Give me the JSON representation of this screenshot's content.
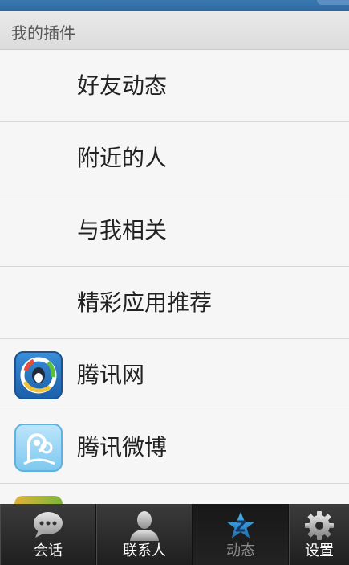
{
  "section": {
    "title": "我的插件"
  },
  "items": [
    {
      "label": "好友动态",
      "icon": null
    },
    {
      "label": "附近的人",
      "icon": null
    },
    {
      "label": "与我相关",
      "icon": null
    },
    {
      "label": "精彩应用推荐",
      "icon": null
    },
    {
      "label": "腾讯网",
      "icon": "tencent-news-icon"
    },
    {
      "label": "腾讯微博",
      "icon": "tencent-weibo-icon"
    }
  ],
  "tabs": [
    {
      "label": "会话",
      "icon": "chat-bubble-icon",
      "active": false
    },
    {
      "label": "联系人",
      "icon": "contacts-icon",
      "active": false
    },
    {
      "label": "动态",
      "icon": "star-icon",
      "active": true
    },
    {
      "label": "设置",
      "icon": "gear-icon",
      "active": false
    }
  ],
  "colors": {
    "topbar": "#2f6aa3",
    "tabbar": "#2a2a2a",
    "active_tab_label": "#8a8a8a"
  }
}
